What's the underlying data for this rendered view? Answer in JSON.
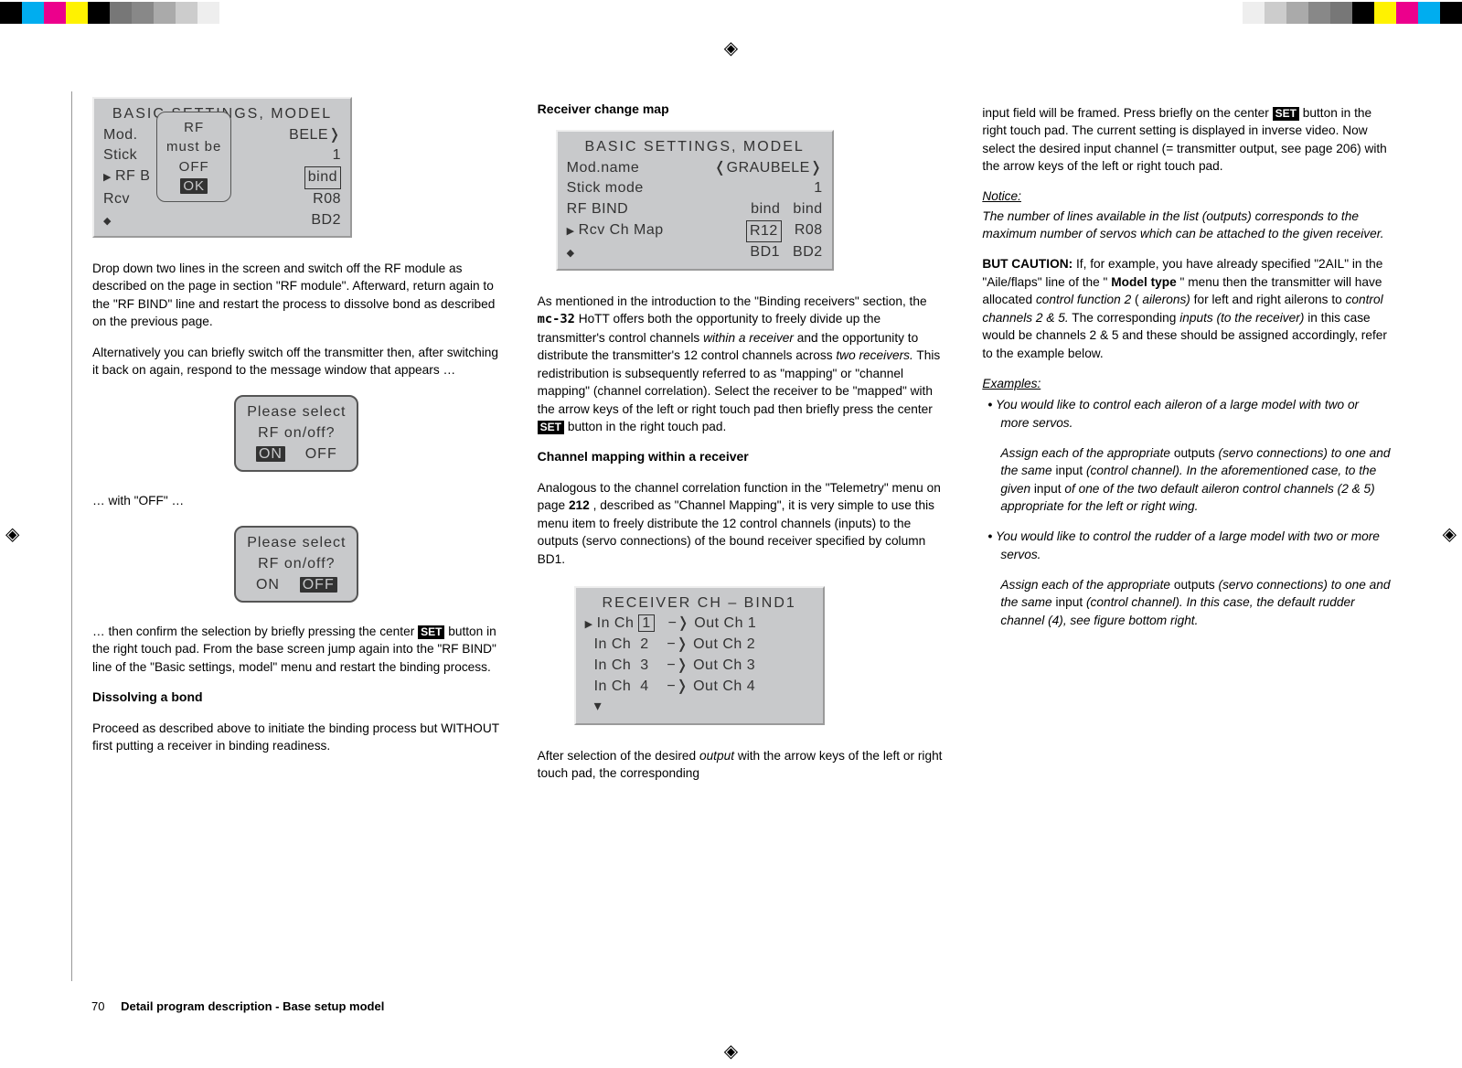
{
  "page": {
    "number": "70",
    "section_title": "Detail program description - Base setup model"
  },
  "col1": {
    "lcd_main": {
      "title": "BASIC  SETTINGS,  MODEL",
      "rows": [
        {
          "l": "Mod.",
          "r": "BELE❭"
        },
        {
          "l": "Stick",
          "r": "1"
        },
        {
          "l": "RF B",
          "r": "bind",
          "ptr": true,
          "r_framed": true
        },
        {
          "l": "Rcv",
          "r": "R08"
        },
        {
          "l": "",
          "r": "BD2",
          "updown": true
        }
      ],
      "popup": {
        "l1": "RF",
        "l2": "must  be",
        "l3": "OFF",
        "ok": "OK"
      }
    },
    "p1": "Drop down two lines in the screen and switch off the RF module as described on the page in section \"RF module\". Afterward, return again to the \"RF BIND\" line and restart the process to dissolve bond as described on the previous page.",
    "p2": "Alternatively you can briefly switch off the transmitter then, after switching it back on again, respond to the message window that appears …",
    "popup1": {
      "l1": "Please select",
      "l2": "RF on/off?",
      "on": "ON",
      "off": "OFF",
      "on_selected": true
    },
    "p3": "… with \"OFF\" …",
    "popup2": {
      "l1": "Please select",
      "l2": "RF on/off?",
      "on": "ON",
      "off": "OFF",
      "off_selected": true
    },
    "p4_a": "… then confirm the selection by briefly pressing the center ",
    "p4_btn": "SET",
    "p4_b": " button in the right touch pad. From the base screen jump again into the \"RF BIND\" line of the \"Basic settings, model\" menu and restart the binding process.",
    "h_dissolve": "Dissolving a bond",
    "p5": "Proceed as described above to initiate the binding process but WITHOUT first putting a receiver in binding readiness."
  },
  "col2": {
    "h_rcm": "Receiver change map",
    "lcd_rcm": {
      "title": "BASIC  SETTINGS,  MODEL",
      "rows": [
        {
          "l": "Mod.name",
          "r": "❬GRAUBELE❭"
        },
        {
          "l": "Stick mode",
          "r": "1"
        },
        {
          "l": "RF BIND",
          "m": "bind",
          "r": "bind"
        },
        {
          "l": "Rcv Ch Map",
          "m": "R12",
          "r": "R08",
          "ptr": true,
          "m_framed": true
        },
        {
          "l": "",
          "m": "BD1",
          "r": "BD2",
          "updown": true
        }
      ]
    },
    "p6_a": "As mentioned in the introduction to the \"Binding receivers\" section, the ",
    "mc32": "mc-32",
    "p6_b": " HoTT offers both the opportunity to freely divide up the transmitter's control channels ",
    "p6_c": "within a receiver",
    "p6_d": " and the opportunity to distribute the transmitter's 12 control channels across ",
    "p6_e": "two receivers.",
    "p6_f": " This redistribution is subsequently referred to as \"mapping\" or \"channel mapping\" (channel correlation). Select the receiver to be \"mapped\" with the arrow keys of the left or right touch pad then briefly press the center ",
    "p6_btn": "SET",
    "p6_g": " button in the right touch pad.",
    "h_cm": "Channel mapping within a receiver",
    "p7_a": "Analogous to the channel correlation function in the \"Telemetry\" menu on page ",
    "p7_pg": "212",
    "p7_b": ", described as \"Channel Mapping\", it is very simple to use this menu item to freely distribute the 12 control channels (inputs) to the outputs (servo connections) of the bound receiver specified by column BD1.",
    "lcd_bind1": {
      "title": "RECEIVER CH – BIND1",
      "rows": [
        {
          "in": "In Ch",
          "n_in": "1",
          "out": "Out Ch  1",
          "ptr": true,
          "n_framed": true
        },
        {
          "in": "In Ch",
          "n_in": "2",
          "out": "Out Ch  2"
        },
        {
          "in": "In Ch",
          "n_in": "3",
          "out": "Out Ch  3"
        },
        {
          "in": "In Ch",
          "n_in": "4",
          "out": "Out Ch  4"
        }
      ],
      "down_arrow": "▾"
    },
    "p8_a": "After selection of the desired ",
    "p8_b": "output",
    "p8_c": " with the arrow keys of the left or right touch pad, the corresponding"
  },
  "col3": {
    "p9_a": "input field will be framed. Press briefly on the center ",
    "p9_btn": "SET",
    "p9_b": " button in the right touch pad. The current setting is displayed in inverse video. Now select the desired input channel (= transmitter output, see page 206) with the arrow keys of the left or right touch pad.",
    "h_notice": "Notice:",
    "p10": "The number of lines available in the list (outputs) corresponds to the maximum number of servos which can be attached to the given receiver.",
    "p11_a": "BUT CAUTION:",
    "p11_b": " If, for example, you have already specified \"2AIL\" in the \"Aile/flaps\" line of the \"",
    "p11_c": "Model type",
    "p11_d": "\" menu then the transmitter will have allocated ",
    "p11_e": "control function 2 ",
    "p11_f": "(",
    "p11_g": "ailerons)",
    "p11_h": " for left and right ailerons to ",
    "p11_i": "control channels 2 & 5.",
    "p11_j": " The corresponding ",
    "p11_k": "inputs (to the receiver)",
    "p11_l": " in this case would be channels 2 & 5 and these should be assigned accordingly, refer to the example below.",
    "h_examples": "Examples:",
    "ex1_a": "You would like to control each aileron of a large model with two or more servos.",
    "ex1_b_a": "Assign each of the appropriate",
    "ex1_b_b": " outputs ",
    "ex1_b_c": "(servo connections) to one and the same",
    "ex1_b_d": " input ",
    "ex1_b_e": "(control channel). In the aforementioned case, to the given ",
    "ex1_b_e2": "input ",
    "ex1_b_f": "of one of the two default aileron control channels (2 & 5) appropriate for the left or right wing.",
    "ex2_a": "You would like to control the rudder of a large model with two or more servos.",
    "ex2_b_a": "Assign each of the appropriate",
    "ex2_b_b": " outputs ",
    "ex2_b_c": "(servo connections) to one and the same",
    "ex2_b_d": " input ",
    "ex2_b_e": "(control channel). In this case, the default rudder channel (4), see figure bottom right."
  }
}
